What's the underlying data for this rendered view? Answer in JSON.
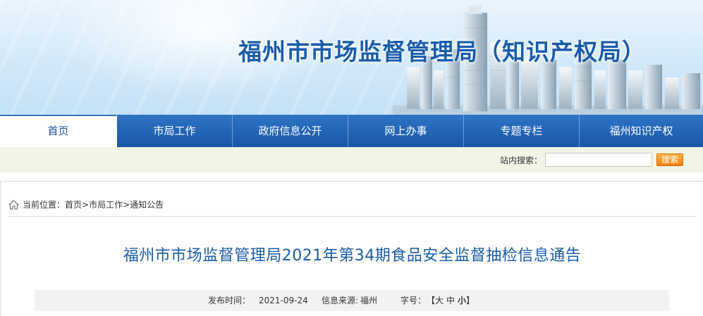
{
  "header": {
    "site_title": "福州市市场监督管理局（知识产权局）"
  },
  "nav": {
    "items": [
      {
        "label": "首页",
        "active": true
      },
      {
        "label": "市局工作",
        "active": false
      },
      {
        "label": "政府信息公开",
        "active": false
      },
      {
        "label": "网上办事",
        "active": false
      },
      {
        "label": "专题专栏",
        "active": false
      },
      {
        "label": "福州知识产权",
        "active": false
      }
    ]
  },
  "search": {
    "label": "站内搜索：",
    "value": "",
    "button_label": "搜索"
  },
  "breadcrumb": {
    "prefix": "当前位置：",
    "items": [
      "首页",
      "市局工作",
      "通知公告"
    ],
    "separator": ">"
  },
  "article": {
    "title": "福州市市场监督管理局2021年第34期食品安全监督抽检信息通告",
    "publish_label": "发布时间：",
    "publish_date": "2021-09-24",
    "source_label": "信息来源:",
    "source_value": "福州",
    "fontsize_label": "字号：",
    "fontsize_open": "【",
    "fontsize_large": "大",
    "fontsize_medium": "中",
    "fontsize_small": "小",
    "fontsize_close": "】"
  },
  "colors": {
    "title_blue": "#1b5cab",
    "nav_blue": "#2f74c6",
    "search_orange": "#ee7f0e",
    "searchbar_bg": "#f1f5e6"
  }
}
